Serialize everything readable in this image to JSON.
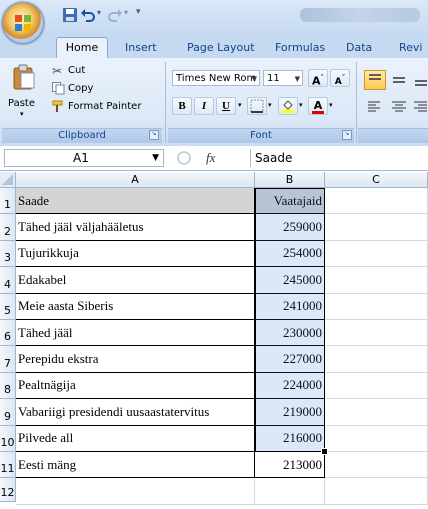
{
  "window": {
    "tabs": [
      "Home",
      "Insert",
      "Page Layout",
      "Formulas",
      "Data",
      "Revi"
    ],
    "active_tab": "Home"
  },
  "clipboard": {
    "paste": "Paste",
    "cut": "Cut",
    "copy": "Copy",
    "format_painter": "Format Painter",
    "group_label": "Clipboard"
  },
  "font": {
    "name": "Times New Rom",
    "size": "11",
    "bold": "B",
    "italic": "I",
    "underline": "U",
    "grow": "A",
    "shrink": "A",
    "font_color": "A",
    "group_label": "Font"
  },
  "formula_bar": {
    "name_box": "A1",
    "fx": "fx",
    "content": "Saade"
  },
  "grid": {
    "columns": [
      "A",
      "B",
      "C"
    ],
    "row_numbers": [
      "1",
      "2",
      "3",
      "4",
      "5",
      "6",
      "7",
      "8",
      "9",
      "10",
      "11",
      "12"
    ],
    "header": [
      "Saade",
      "Vaatajaid"
    ],
    "rows": [
      [
        "Tähed jääl väljahääletus",
        "259000"
      ],
      [
        "Tujurikkuja",
        "254000"
      ],
      [
        "Edakabel",
        "245000"
      ],
      [
        "Meie aasta Siberis",
        "241000"
      ],
      [
        "Tähed jääl",
        "230000"
      ],
      [
        "Perepidu ekstra",
        "227000"
      ],
      [
        "Pealtnägija",
        "224000"
      ],
      [
        "Vabariigi presidendi uusaastatervitus",
        "219000"
      ],
      [
        "Pilvede all",
        "216000"
      ],
      [
        "Eesti mäng",
        "213000"
      ]
    ]
  },
  "colors": {
    "ribbon": "#dce8f7",
    "tab_text": "#15428b",
    "header_fill": "#d4d4d4",
    "selection_header": "#f1c15f"
  }
}
